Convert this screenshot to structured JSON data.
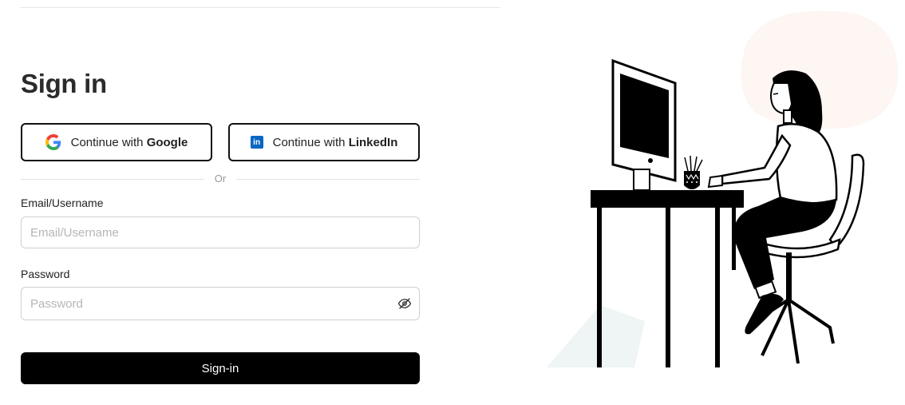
{
  "signin": {
    "title": "Sign in",
    "google_prefix": "Continue with ",
    "google_brand": "Google",
    "linkedin_prefix": "Continue with ",
    "linkedin_brand": "LinkedIn",
    "linkedin_badge": "in",
    "divider_text": "Or",
    "email_label": "Email/Username",
    "email_placeholder": "Email/Username",
    "email_value": "",
    "password_label": "Password",
    "password_placeholder": "Password",
    "password_value": "",
    "submit_label": "Sign-in"
  },
  "colors": {
    "primary_button": "#000000",
    "linkedin_blue": "#0a66c2",
    "accent_circle": "#fdf6f3",
    "accent_triangle": "#eef5f4"
  },
  "icons": {
    "google": "google-g-icon",
    "linkedin": "linkedin-icon",
    "password_toggle": "eye-slash-icon"
  }
}
